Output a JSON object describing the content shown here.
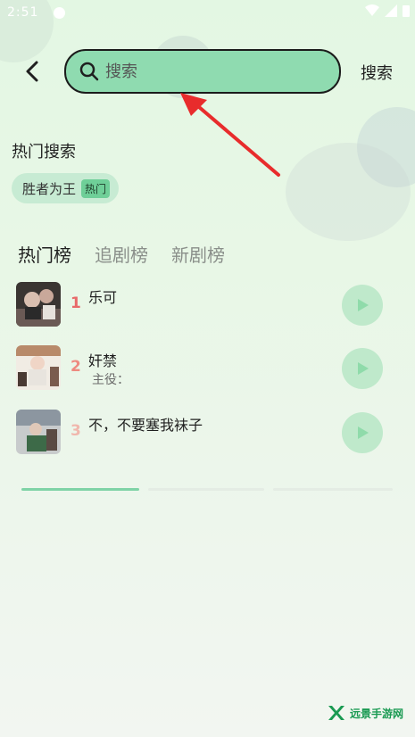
{
  "status_bar": {
    "time": "2:51"
  },
  "top_bar": {
    "search_placeholder": "搜索",
    "search_button_label": "搜索"
  },
  "hot_search": {
    "title": "热门搜索",
    "chips": [
      {
        "label": "胜者为王",
        "badge": "热门"
      }
    ]
  },
  "tabs": [
    {
      "label": "热门榜",
      "active": true
    },
    {
      "label": "追剧榜",
      "active": false
    },
    {
      "label": "新剧榜",
      "active": false
    }
  ],
  "ranking": [
    {
      "rank": "1",
      "title": "乐可",
      "subtitle": "",
      "rank_color": "#e86b6b"
    },
    {
      "rank": "2",
      "title": "奸禁",
      "subtitle": "主役：",
      "rank_color": "#ee8a80"
    },
    {
      "rank": "3",
      "title": "不，不要塞我袜子",
      "subtitle": "",
      "rank_color": "#f0b7ad"
    }
  ],
  "pager": {
    "count": 3,
    "active_index": 0
  },
  "watermark": {
    "text": "远景手游网"
  },
  "colors": {
    "accent": "#8fdbb0",
    "active_indicator": "#7fd3a6",
    "play_button": "#bfe9cb"
  }
}
